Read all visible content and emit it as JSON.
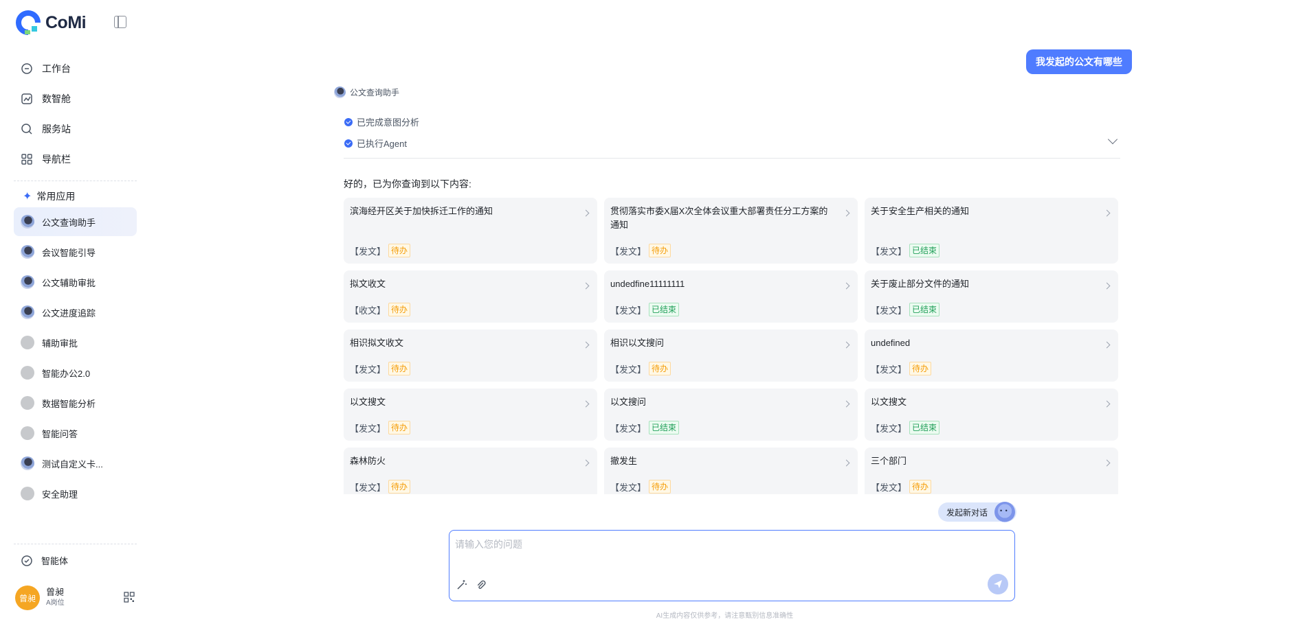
{
  "app": {
    "logo_text": "CoMi"
  },
  "sidebar": {
    "nav": [
      {
        "label": "工作台",
        "icon": "workbench-icon"
      },
      {
        "label": "数智舱",
        "icon": "chart-icon"
      },
      {
        "label": "服务站",
        "icon": "search-icon"
      },
      {
        "label": "导航栏",
        "icon": "grid-icon"
      }
    ],
    "section_title": "常用应用",
    "apps": [
      {
        "label": "公文查询助手",
        "avatar": "img",
        "active": true
      },
      {
        "label": "会议智能引导",
        "avatar": "img"
      },
      {
        "label": "公文辅助审批",
        "avatar": "img"
      },
      {
        "label": "公文进度追踪",
        "avatar": "img"
      },
      {
        "label": "辅助审批",
        "avatar": "grey"
      },
      {
        "label": "智能办公2.0",
        "avatar": "grey"
      },
      {
        "label": "数据智能分析",
        "avatar": "grey"
      },
      {
        "label": "智能问答",
        "avatar": "grey"
      },
      {
        "label": "测试自定义卡...",
        "avatar": "img"
      },
      {
        "label": "安全助理",
        "avatar": "grey"
      }
    ],
    "bottom_item": "智能体",
    "user": {
      "avatar_text": "曾昶",
      "name": "曾昶",
      "role": "A岗位"
    }
  },
  "chat": {
    "user_message": "我发起的公文有哪些",
    "assistant_name": "公文查询助手",
    "steps": [
      "已完成意图分析",
      "已执行Agent"
    ],
    "intro": "好的，已为你查询到以下内容:",
    "cards": [
      {
        "title": "滨海经开区关于加快拆迁工作的通知",
        "type": "【发文】",
        "status": "待办",
        "state": "pending"
      },
      {
        "title": "贯彻落实市委X届X次全体会议重大部署责任分工方案的通知",
        "type": "【发文】",
        "status": "待办",
        "state": "pending"
      },
      {
        "title": "关于安全生产相关的通知",
        "type": "【发文】",
        "status": "已结束",
        "state": "done"
      },
      {
        "title": "拟文收文",
        "type": "【收文】",
        "status": "待办",
        "state": "pending"
      },
      {
        "title": "undedfine11111111",
        "type": "【发文】",
        "status": "已结束",
        "state": "done"
      },
      {
        "title": "关于废止部分文件的通知",
        "type": "【发文】",
        "status": "已结束",
        "state": "done"
      },
      {
        "title": "相识拟文收文",
        "type": "【发文】",
        "status": "待办",
        "state": "pending"
      },
      {
        "title": "相识以文搜问",
        "type": "【发文】",
        "status": "待办",
        "state": "pending"
      },
      {
        "title": "undefined",
        "type": "【发文】",
        "status": "待办",
        "state": "pending"
      },
      {
        "title": "以文搜文",
        "type": "【发文】",
        "status": "待办",
        "state": "pending"
      },
      {
        "title": "以文搜问",
        "type": "【发文】",
        "status": "已结束",
        "state": "done"
      },
      {
        "title": "以文搜文",
        "type": "【发文】",
        "status": "已结束",
        "state": "done"
      },
      {
        "title": "森林防火",
        "type": "【发文】",
        "status": "待办",
        "state": "pending"
      },
      {
        "title": "撤发生",
        "type": "【发文】",
        "status": "待办",
        "state": "pending"
      },
      {
        "title": "三个部门",
        "type": "【发文】",
        "status": "待办",
        "state": "pending"
      }
    ],
    "new_chat_label": "发起新对话",
    "input_placeholder": "请输入您的问题",
    "disclaimer": "AI生成内容仅供参考，请注意甄别信息准确性"
  },
  "colors": {
    "accent": "#4f7cff",
    "pending": "#f59e0b",
    "done": "#22a05a"
  }
}
